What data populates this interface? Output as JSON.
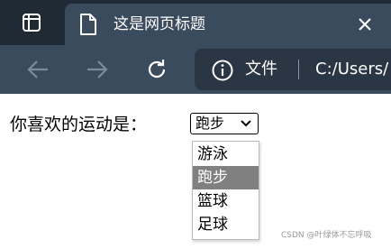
{
  "browser": {
    "tab": {
      "title": "这是网页标题"
    },
    "address": {
      "site_label": "文件",
      "url": "C:/Users/"
    }
  },
  "page": {
    "question_label": "你喜欢的运动是：",
    "select": {
      "selected": "跑步",
      "options": [
        "游泳",
        "跑步",
        "篮球",
        "足球"
      ],
      "highlighted_index": 1
    }
  },
  "watermark": "CSDN @叶绿体不忘呼吸",
  "colors": {
    "tabstrip_bg": "#202a35",
    "toolbar_bg": "#3b4b5e",
    "addressbar_bg": "#2a3644",
    "option_highlight": "#808080"
  }
}
